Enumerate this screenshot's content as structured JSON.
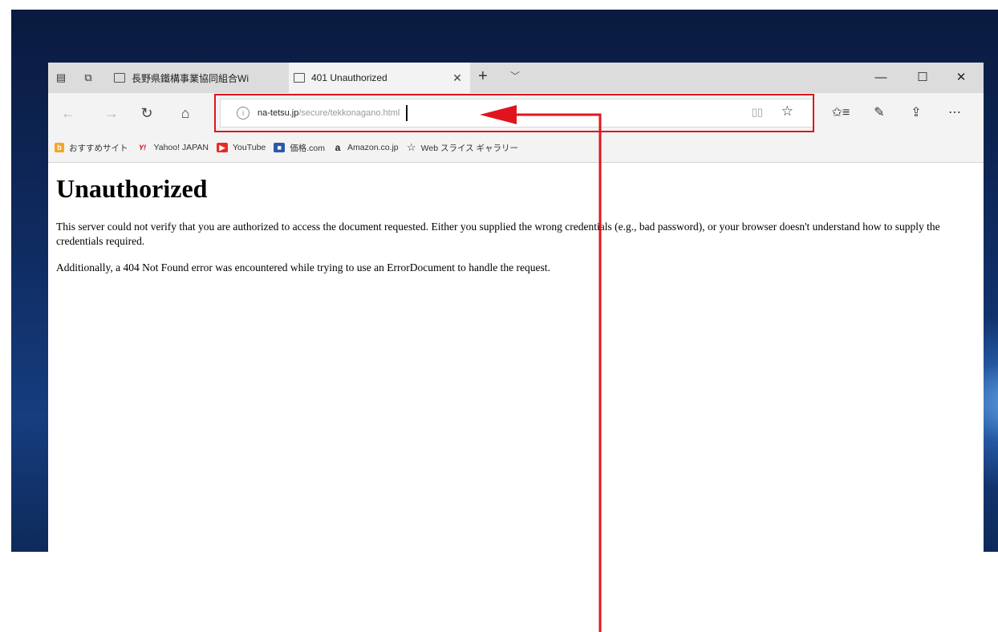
{
  "titlebar": {
    "tabs": [
      {
        "label": "長野県鐵構事業協同組合Wi",
        "active": false
      },
      {
        "label": "401 Unauthorized",
        "active": true
      }
    ],
    "new_tab": "+",
    "tab_list": "﹀"
  },
  "address_bar": {
    "host": "na-tetsu.jp",
    "path": "/secure/tekkonagano.html"
  },
  "favorites_bar": {
    "items": [
      {
        "label": "おすすめサイト",
        "icon": "bing-icon",
        "color": "#f5a623"
      },
      {
        "label": "Yahoo! JAPAN",
        "icon": "yahoo-icon",
        "color": "#e60012"
      },
      {
        "label": "YouTube",
        "icon": "youtube-icon",
        "color": "#e52d27"
      },
      {
        "label": "価格.com",
        "icon": "kakaku-icon",
        "color": "#2a5aa8"
      },
      {
        "label": "Amazon.co.jp",
        "icon": "amazon-icon",
        "color": "#222222"
      },
      {
        "label": "Web スライス ギャラリー",
        "icon": "star-outline-icon",
        "color": "#333333"
      }
    ]
  },
  "page": {
    "heading": "Unauthorized",
    "paragraph1": "This server could not verify that you are authorized to access the document requested. Either you supplied the wrong credentials (e.g., bad password), or your browser doesn't understand how to supply the credentials required.",
    "paragraph2": "Additionally, a 404 Not Found error was encountered while trying to use an ErrorDocument to handle the request."
  },
  "annotation": {
    "color": "#e0141e"
  }
}
